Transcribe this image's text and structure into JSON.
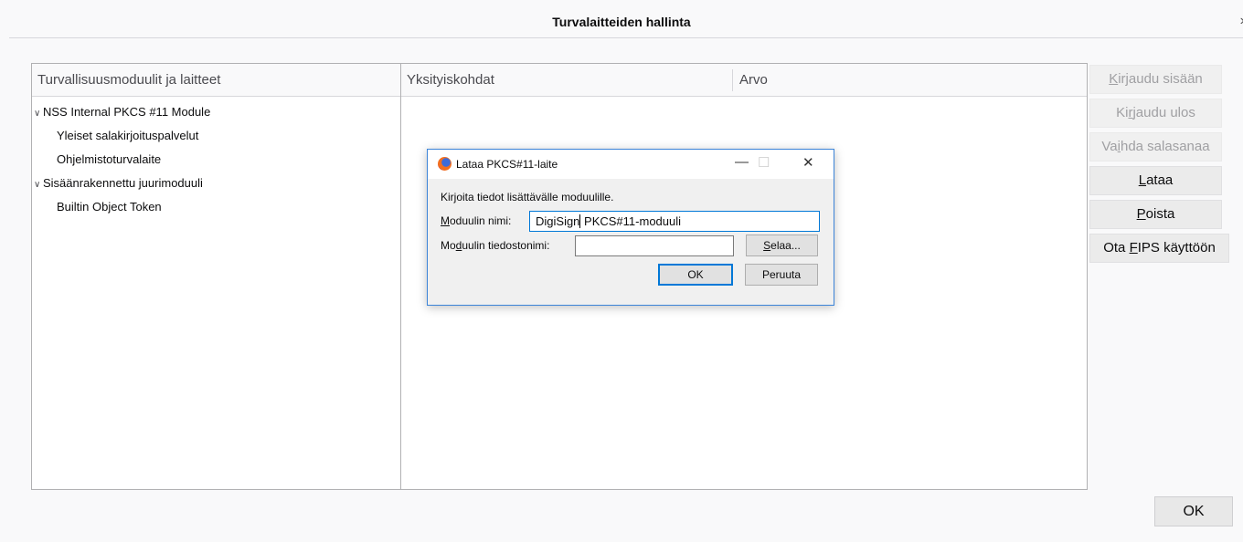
{
  "window": {
    "title": "Turvalaitteiden hallinta",
    "close_glyph": "›"
  },
  "tree": {
    "header": "Turvallisuusmoduulit ja laitteet",
    "items": [
      {
        "label": "NSS Internal PKCS #11 Module",
        "level": 0,
        "expanded": true
      },
      {
        "label": "Yleiset salakirjoituspalvelut",
        "level": 1
      },
      {
        "label": "Ohjelmistoturvalaite",
        "level": 1
      },
      {
        "label": "Sisäänrakennettu juurimoduuli",
        "level": 0,
        "expanded": true
      },
      {
        "label": "Builtin Object Token",
        "level": 1
      }
    ]
  },
  "details": {
    "col_details": "Yksityiskohdat",
    "col_value": "Arvo"
  },
  "side_buttons": {
    "login": {
      "pre": "",
      "key": "K",
      "post": "irjaudu sisään"
    },
    "logout": {
      "pre": "Ki",
      "key": "r",
      "post": "jaudu ulos"
    },
    "change_pw": {
      "pre": "Va",
      "key": "i",
      "post": "hda salasanaa"
    },
    "load": {
      "pre": "",
      "key": "L",
      "post": "ataa"
    },
    "delete": {
      "pre": "",
      "key": "P",
      "post": "oista"
    },
    "fips": {
      "pre": "Ota ",
      "key": "F",
      "post": "IPS käyttöön"
    }
  },
  "ok_label": "OK",
  "dialog": {
    "title": "Lataa PKCS#11-laite",
    "minimize": "—",
    "maximize": "☐",
    "close": "✕",
    "intro": "Kirjoita tiedot lisättävälle moduulille.",
    "name_label": {
      "pre": "",
      "key": "M",
      "post": "oduulin nimi:"
    },
    "name_value_before_caret": "DigiSign",
    "name_value_after_caret": " PKCS#11-moduuli",
    "file_label": {
      "pre": "Mo",
      "key": "d",
      "post": "uulin tiedostonimi:"
    },
    "file_value": "",
    "browse": {
      "pre": "",
      "key": "S",
      "post": "elaa..."
    },
    "ok": "OK",
    "cancel": "Peruuta"
  }
}
